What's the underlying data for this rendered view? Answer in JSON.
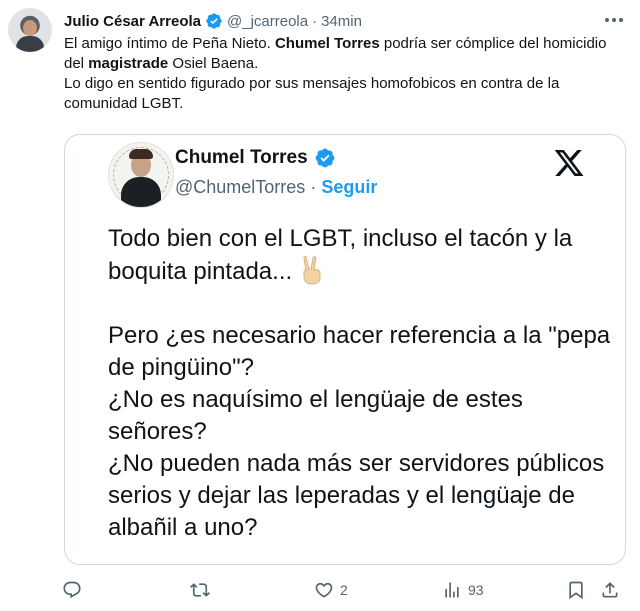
{
  "author": {
    "name": "Julio César Arreola",
    "handle": "@_jcarreola",
    "separator": "·",
    "time": "34min"
  },
  "tweet": {
    "line1_a": "El amigo íntimo de Peña Nieto. ",
    "line1_b": "Chumel Torres",
    "line1_c": " podría ser cómplice del homicidio del ",
    "line1_d": "magistrade",
    "line1_e": " Osiel Baena.",
    "line2": "Lo digo en sentido figurado por sus mensajes homofobicos en contra de la comunidad LGBT."
  },
  "quote": {
    "name": "Chumel Torres",
    "handle": "@ChumelTorres",
    "separator": "·",
    "follow_label": "Seguir",
    "p1": "Todo bien con el LGBT, incluso el tacón y la boquita pintada...",
    "p2": "Pero ¿es necesario hacer referencia a la \"pepa de pingüino\"?",
    "p3": "¿No es naquísimo el lengüaje de estes señores?",
    "p4": "¿No pueden nada más ser servidores públicos serios y dejar las leperadas y el lengüaje de albañil a uno?"
  },
  "actions": {
    "likes": "2",
    "views": "93"
  },
  "icons": {
    "verified": "verified-badge-icon",
    "more": "more-icon",
    "x_logo": "x-logo-icon",
    "reply": "reply-icon",
    "retweet": "retweet-icon",
    "like": "like-icon",
    "views": "views-icon",
    "bookmark": "bookmark-icon",
    "share": "share-icon"
  },
  "colors": {
    "accent": "#1d9bf0",
    "secondary_text": "#536471",
    "border": "#cfd9de"
  }
}
